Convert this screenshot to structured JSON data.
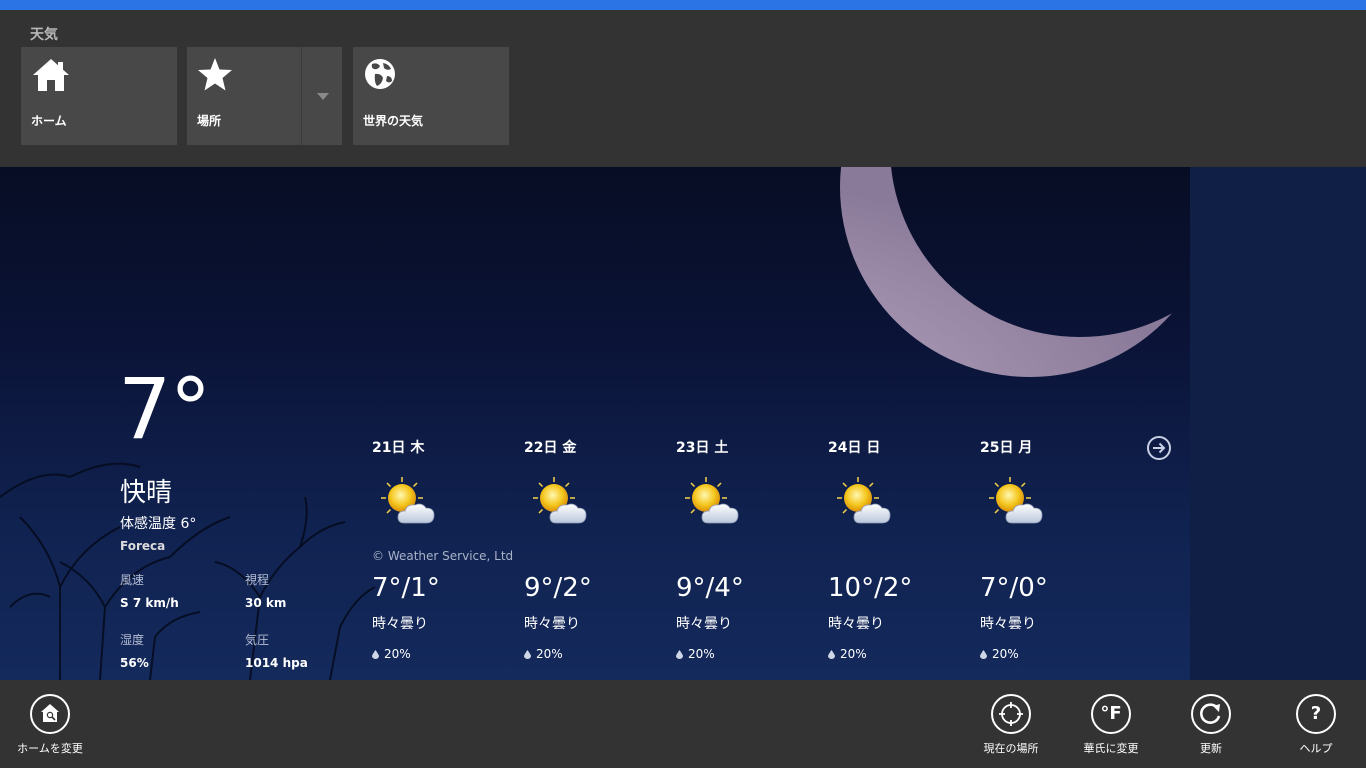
{
  "app": {
    "title": "天気",
    "accent_color": "#2b74e6"
  },
  "nav": {
    "home_label": "ホーム",
    "places_label": "場所",
    "world_label": "世界の天気"
  },
  "current": {
    "temperature": "7°",
    "condition": "快晴",
    "feels_like": "体感温度 6°",
    "source": "Foreca",
    "wind_label": "風速",
    "wind_value": "S 7 km/h",
    "visibility_label": "視程",
    "visibility_value": "30 km",
    "humidity_label": "湿度",
    "humidity_value": "56%",
    "pressure_label": "気圧",
    "pressure_value": "1014 hpa"
  },
  "forecast": {
    "credit": "© Weather Service, Ltd",
    "days": [
      {
        "date": "21日 木",
        "temps": "7°/1°",
        "condition": "時々曇り",
        "precip": "20%",
        "icon": "partly-cloudy-icon"
      },
      {
        "date": "22日 金",
        "temps": "9°/2°",
        "condition": "時々曇り",
        "precip": "20%",
        "icon": "partly-cloudy-icon"
      },
      {
        "date": "23日 土",
        "temps": "9°/4°",
        "condition": "時々曇り",
        "precip": "20%",
        "icon": "partly-cloudy-icon"
      },
      {
        "date": "24日 日",
        "temps": "10°/2°",
        "condition": "時々曇り",
        "precip": "20%",
        "icon": "partly-cloudy-icon"
      },
      {
        "date": "25日 月",
        "temps": "7°/0°",
        "condition": "時々曇り",
        "precip": "20%",
        "icon": "partly-cloudy-icon"
      }
    ]
  },
  "appbar": {
    "change_home": "ホームを変更",
    "current_location": "現在の場所",
    "fahrenheit": "華氏に変更",
    "fahrenheit_glyph": "°F",
    "refresh": "更新",
    "help": "ヘルプ",
    "help_glyph": "?"
  }
}
